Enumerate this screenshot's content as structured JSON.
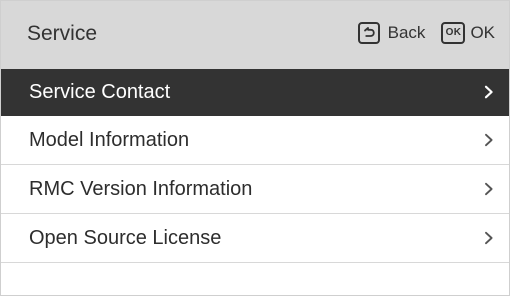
{
  "header": {
    "title": "Service",
    "back_label": "Back",
    "ok_icon_text": "OK",
    "ok_label": "OK"
  },
  "menu": {
    "items": [
      {
        "label": "Service Contact",
        "selected": true,
        "icon": "chevron-right-icon"
      },
      {
        "label": "Model Information",
        "selected": false,
        "icon": "chevron-right-icon"
      },
      {
        "label": "RMC Version Information",
        "selected": false,
        "icon": "chevron-right-icon"
      },
      {
        "label": "Open Source License",
        "selected": false,
        "icon": "chevron-right-icon"
      }
    ]
  },
  "colors": {
    "header_bg": "#d8d8d8",
    "selected_bg": "#333333",
    "selected_text": "#ffffff",
    "text": "#2d2d2d",
    "divider": "#d8d8d8"
  },
  "icons": {
    "back": "back-icon",
    "ok": "ok-icon",
    "chevron": "chevron-right-icon"
  }
}
